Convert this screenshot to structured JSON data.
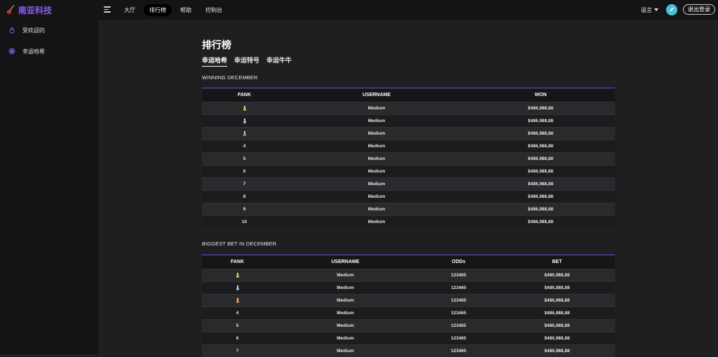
{
  "brand": {
    "name": "南亚科技",
    "logo_icon": "guitar-icon",
    "color": "#8b5cf6"
  },
  "nav": {
    "items": [
      {
        "label": "大厅"
      },
      {
        "label": "排行榜",
        "active": true
      },
      {
        "label": "帮助"
      },
      {
        "label": "控制台"
      }
    ]
  },
  "header": {
    "language_label": "语言",
    "logout_label": "退出登录"
  },
  "sidebar": {
    "items": [
      {
        "label": "受欢迎的",
        "icon": "flame-icon"
      },
      {
        "label": "幸运哈希",
        "icon": "atom-icon"
      }
    ]
  },
  "main": {
    "title": "排行榜",
    "tabs": [
      {
        "label": "幸运哈希",
        "active": true
      },
      {
        "label": "幸运特号"
      },
      {
        "label": "幸运牛牛"
      }
    ]
  },
  "winning_board": {
    "title": "WINNING DECEMBER",
    "columns": [
      "FANK",
      "USERNAME",
      "WON"
    ],
    "rows": [
      {
        "rank": "1",
        "username": "Medium",
        "won": "$486,988,88"
      },
      {
        "rank": "2",
        "username": "Medium",
        "won": "$486,988,88"
      },
      {
        "rank": "3",
        "username": "Medium",
        "won": "$486,988,88"
      },
      {
        "rank": "4",
        "username": "Medium",
        "won": "$486,988,88"
      },
      {
        "rank": "5",
        "username": "Medium",
        "won": "$486,988,88"
      },
      {
        "rank": "6",
        "username": "Medium",
        "won": "$486,988,88"
      },
      {
        "rank": "7",
        "username": "Medium",
        "won": "$486,988,88"
      },
      {
        "rank": "8",
        "username": "Medium",
        "won": "$486,988,88"
      },
      {
        "rank": "9",
        "username": "Medium",
        "won": "$486,988,88"
      },
      {
        "rank": "10",
        "username": "Medium",
        "won": "$486,988,88"
      }
    ]
  },
  "bet_board": {
    "title": "BIGGEST BET IN DECEMBER",
    "columns": [
      "FANK",
      "USERNAME",
      "ODDs",
      "BET"
    ],
    "rows": [
      {
        "rank": "1",
        "username": "Medium",
        "odds": "123465",
        "bet": "$486,988,88"
      },
      {
        "rank": "2",
        "username": "Medium",
        "odds": "123465",
        "bet": "$486,988,88"
      },
      {
        "rank": "3",
        "username": "Medium",
        "odds": "123465",
        "bet": "$486,988,88"
      },
      {
        "rank": "4",
        "username": "Medium",
        "odds": "123465",
        "bet": "$486,988,88"
      },
      {
        "rank": "5",
        "username": "Medium",
        "odds": "123465",
        "bet": "$486,988,88"
      },
      {
        "rank": "6",
        "username": "Medium",
        "odds": "123465",
        "bet": "$486,988,88"
      },
      {
        "rank": "7",
        "username": "Medium",
        "odds": "123465",
        "bet": "$486,988,88"
      }
    ]
  },
  "medals": {
    "gold": "#e0b13a",
    "silver": "#9fb8c8",
    "bronze": "#d88a3a"
  },
  "colors": {
    "accent": "#6b4fd8",
    "background": "#1f1f21",
    "panel": "#141416"
  }
}
